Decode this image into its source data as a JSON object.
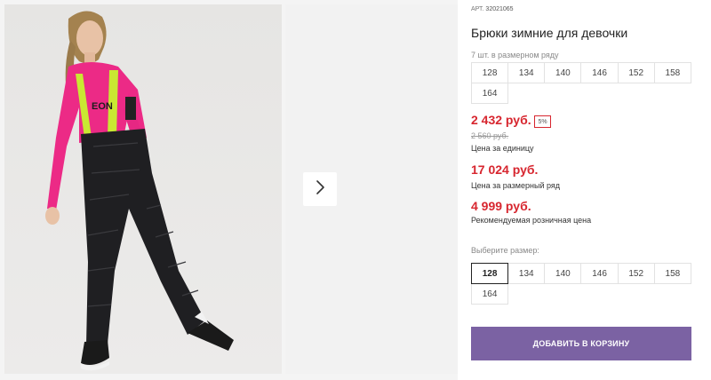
{
  "product": {
    "article_label": "АРТ.",
    "article_number": "32021065",
    "title": "Брюки зимние для девочки",
    "pack_note": "7 шт. в размерном ряду",
    "pack_sizes": [
      "128",
      "134",
      "140",
      "146",
      "152",
      "158",
      "164"
    ]
  },
  "pricing": {
    "unit_price": "2 432 руб.",
    "discount_badge": "5%",
    "old_price": "2 560 руб.",
    "unit_price_note": "Цена за единицу",
    "row_price": "17 024 руб.",
    "row_price_note": "Цена за размерный ряд",
    "rrp_price": "4 999 руб.",
    "rrp_note": "Рекомендуемая розничная цена"
  },
  "size_picker": {
    "label": "Выберите размер:",
    "sizes": [
      "128",
      "134",
      "140",
      "146",
      "152",
      "158",
      "164"
    ],
    "selected": "128"
  },
  "actions": {
    "add_to_cart": "ДОБАВИТЬ В КОРЗИНУ"
  },
  "gallery": {
    "next_icon": "chevron-right-icon"
  },
  "colors": {
    "price_red": "#d7262f",
    "button_purple": "#7b62a3"
  }
}
